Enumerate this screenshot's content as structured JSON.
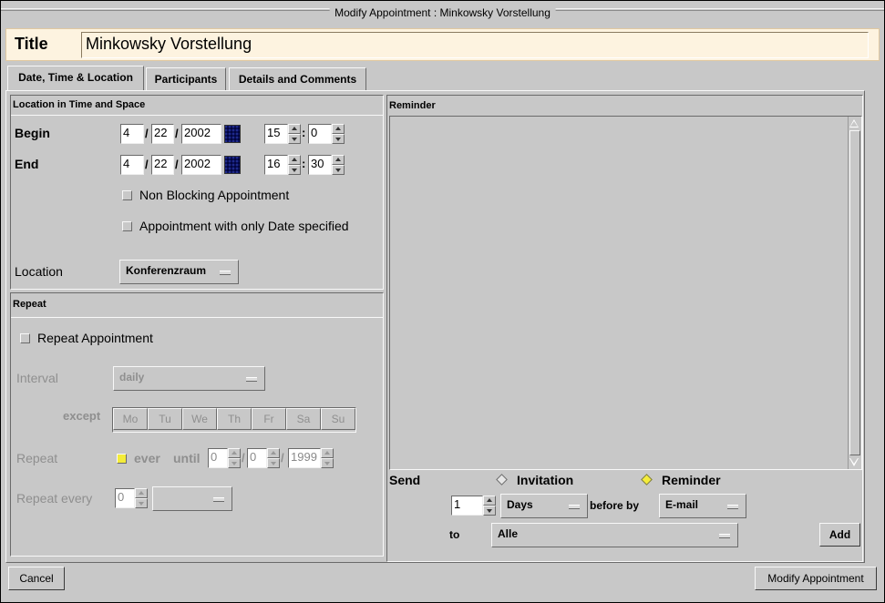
{
  "window": {
    "title": "Modify Appointment : Minkowsky Vorstellung"
  },
  "title_row": {
    "label": "Title",
    "value": "Minkowsky Vorstellung"
  },
  "tabs": [
    {
      "label": "Date, Time & Location"
    },
    {
      "label": "Participants"
    },
    {
      "label": "Details and Comments"
    }
  ],
  "location_group": {
    "header": "Location in Time and Space",
    "begin": {
      "label": "Begin",
      "month": "4",
      "day": "22",
      "year": "2002",
      "hour": "15",
      "minute": "0"
    },
    "end": {
      "label": "End",
      "month": "4",
      "day": "22",
      "year": "2002",
      "hour": "16",
      "minute": "30"
    },
    "date_sep": "/",
    "time_sep": ":",
    "non_blocking": "Non Blocking Appointment",
    "date_only": "Appointment with only Date specified",
    "location_label": "Location",
    "location_value": "Konferenzraum"
  },
  "repeat_group": {
    "header": "Repeat",
    "repeat_checkbox": "Repeat Appointment",
    "interval_label": "Interval",
    "interval_value": "daily",
    "except_label": "except",
    "days": [
      "Mo",
      "Tu",
      "We",
      "Th",
      "Fr",
      "Sa",
      "Su"
    ],
    "repeat_label": "Repeat",
    "ever_label": "ever",
    "until_label": "until",
    "until_month": "0",
    "until_day": "0",
    "until_year": "1999",
    "repeat_every_label": "Repeat every",
    "repeat_every_value": "0",
    "repeat_every_unit": ""
  },
  "reminder_group": {
    "header": "Reminder",
    "send_label": "Send",
    "invitation_label": "Invitation",
    "reminder_label": "Reminder",
    "amount": "1",
    "unit": "Days",
    "before_by_label": "before by",
    "method": "E-mail",
    "to_label": "to",
    "to_value": "Alle",
    "add_button": "Add"
  },
  "footer": {
    "cancel": "Cancel",
    "modify": "Modify Appointment"
  },
  "colors": {
    "background": "#c8c8c8",
    "title_field": "#fdf3e0",
    "checked": "#f4ec3a"
  }
}
